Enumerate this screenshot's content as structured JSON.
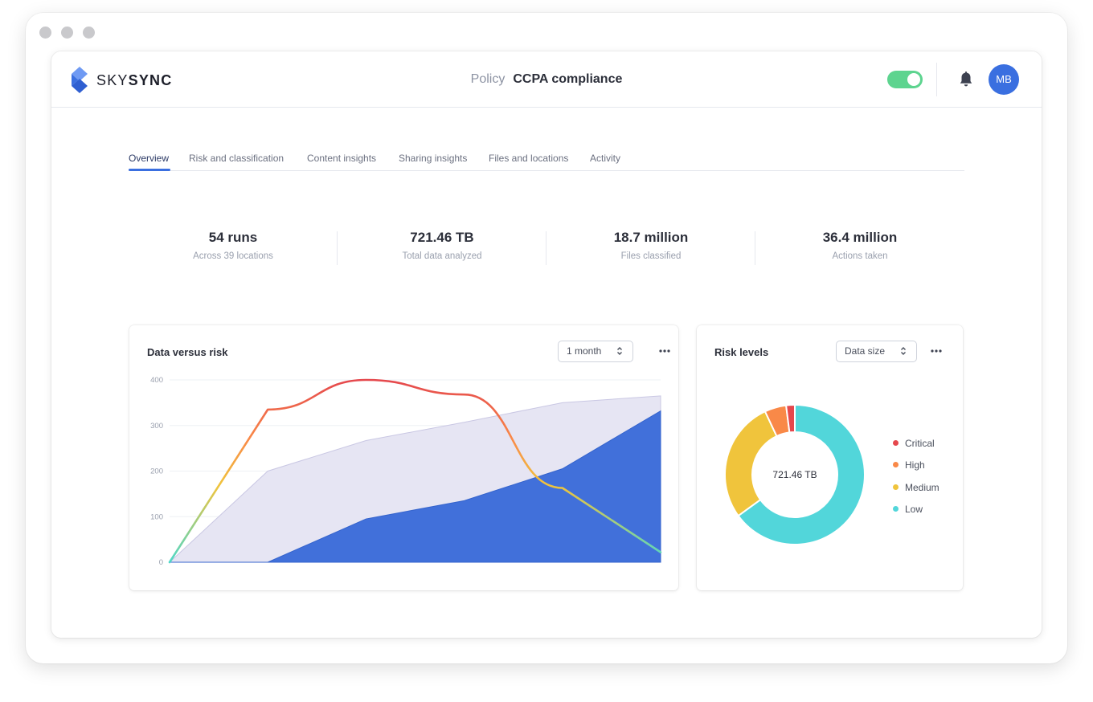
{
  "app": {
    "logo_prefix": "SKY",
    "logo_suffix": "SYNC",
    "breadcrumb_section": "Policy",
    "breadcrumb_title": "CCPA compliance",
    "policy_enabled": true,
    "user_initials": "MB",
    "accent_color": "#3a6fe0",
    "toggle_color": "#5dd48f",
    "icons": [
      "logo-icon",
      "bell-icon",
      "avatar",
      "more-icon",
      "chevron-updown-icon"
    ]
  },
  "tabs": [
    {
      "label": "Overview",
      "active": true
    },
    {
      "label": "Risk and classification",
      "active": false
    },
    {
      "label": "Content insights",
      "active": false
    },
    {
      "label": "Sharing insights",
      "active": false
    },
    {
      "label": "Files and locations",
      "active": false
    },
    {
      "label": "Activity",
      "active": false
    }
  ],
  "stats": [
    {
      "value": "54 runs",
      "label": "Across 39 locations"
    },
    {
      "value": "721.46 TB",
      "label": "Total data analyzed"
    },
    {
      "value": "18.7 million",
      "label": "Files classified"
    },
    {
      "value": "36.4 million",
      "label": "Actions taken"
    }
  ],
  "data_risk_card": {
    "title": "Data versus risk",
    "period_select": "1 month",
    "y_ticks": [
      "400",
      "300",
      "200",
      "100",
      "0"
    ]
  },
  "risk_card": {
    "title": "Risk levels",
    "metric_select": "Data size",
    "center_label": "721.46 TB",
    "legend": [
      {
        "name": "Critical",
        "color": "#e5484d"
      },
      {
        "name": "High",
        "color": "#f98948"
      },
      {
        "name": "Medium",
        "color": "#f0c43c"
      },
      {
        "name": "Low",
        "color": "#52d6da"
      }
    ]
  },
  "chart_data": [
    {
      "type": "area",
      "title": "Data versus risk",
      "ylim": [
        0,
        400
      ],
      "grid": true,
      "x": [
        0,
        1,
        2,
        3,
        4,
        5
      ],
      "series": [
        {
          "kind": "area",
          "color": "#e6e5f3",
          "values": [
            0,
            200,
            267,
            307,
            350,
            365
          ]
        },
        {
          "kind": "area",
          "color": "#4170da",
          "values": [
            0,
            0,
            95,
            135,
            205,
            332
          ]
        },
        {
          "kind": "line",
          "color_stops": [
            "#4ed8c8",
            "#f0c43c",
            "#f98948",
            "#e5484d"
          ],
          "values": [
            0,
            335,
            400,
            368,
            163,
            22
          ]
        }
      ]
    },
    {
      "type": "pie",
      "title": "Risk levels",
      "donut": true,
      "center_text": "721.46 TB",
      "slices": [
        {
          "name": "Critical",
          "value": 2,
          "color": "#e5484d"
        },
        {
          "name": "High",
          "value": 5,
          "color": "#f98948"
        },
        {
          "name": "Medium",
          "value": 28,
          "color": "#f0c43c"
        },
        {
          "name": "Low",
          "value": 65,
          "color": "#52d6da"
        }
      ]
    }
  ]
}
